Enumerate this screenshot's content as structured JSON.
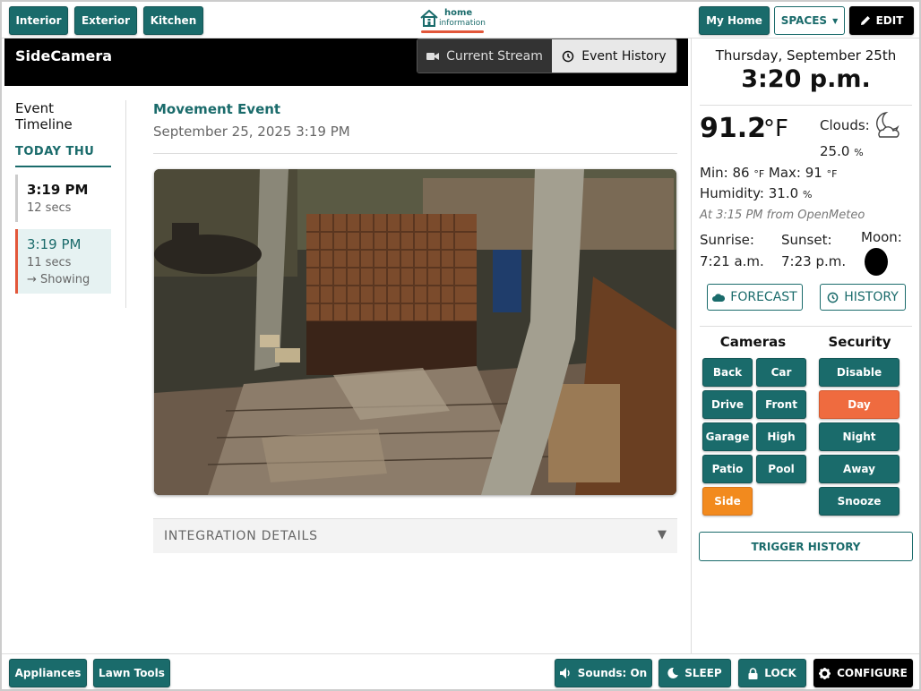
{
  "topbar": {
    "nav": [
      "Interior",
      "Exterior",
      "Kitchen"
    ],
    "logo_line1": "home",
    "logo_line2": "information",
    "my_home": "My Home",
    "spaces": "SPACES",
    "edit": "EDIT"
  },
  "camera": {
    "title": "SideCamera",
    "tab_stream": "Current Stream",
    "tab_history": "Event History"
  },
  "timeline": {
    "title": "Event Timeline",
    "day": "TODAY THU",
    "items": [
      {
        "time": "3:19 PM",
        "duration": "12 secs",
        "status": ""
      },
      {
        "time": "3:19 PM",
        "duration": "11 secs",
        "status": "→ Showing"
      }
    ]
  },
  "event": {
    "title": "Movement Event",
    "date": "September 25, 2025 3:19 PM",
    "integration_label": "INTEGRATION DETAILS",
    "integration_caret": "▼"
  },
  "weather": {
    "date": "Thursday, September 25th",
    "time": "3:20 p.m.",
    "temp": "91.2",
    "temp_unit": "°F",
    "clouds_label": "Clouds:",
    "clouds_value": "25.0",
    "clouds_unit": "%",
    "min_label": "Min: 86",
    "max_label": "Max: 91",
    "deg_unit": "°F",
    "humidity_label": "Humidity: 31.0",
    "humidity_unit": "%",
    "source": "At 3:15 PM from OpenMeteo",
    "sunrise": "Sunrise: 7:21 a.m.",
    "sunset": "Sunset: 7:23 p.m.",
    "moon": "Moon:",
    "forecast_btn": "FORECAST",
    "history_btn": "HISTORY"
  },
  "controls": {
    "cameras_heading": "Cameras",
    "security_heading": "Security",
    "cameras": [
      "Back",
      "Car",
      "Drive",
      "Front",
      "Garage",
      "High",
      "Patio",
      "Pool",
      "Side"
    ],
    "active_camera": "Side",
    "security": [
      "Disable",
      "Day",
      "Night",
      "Away",
      "Snooze"
    ],
    "active_security": "Day",
    "trigger_history": "TRIGGER HISTORY"
  },
  "bottombar": {
    "appliances": "Appliances",
    "lawn_tools": "Lawn Tools",
    "sounds": "Sounds: On",
    "sleep": "SLEEP",
    "lock": "LOCK",
    "configure": "CONFIGURE"
  },
  "colors": {
    "primary": "#1a6b6b",
    "accent_orange": "#f28a1e",
    "accent_red": "#ef6b3f"
  }
}
